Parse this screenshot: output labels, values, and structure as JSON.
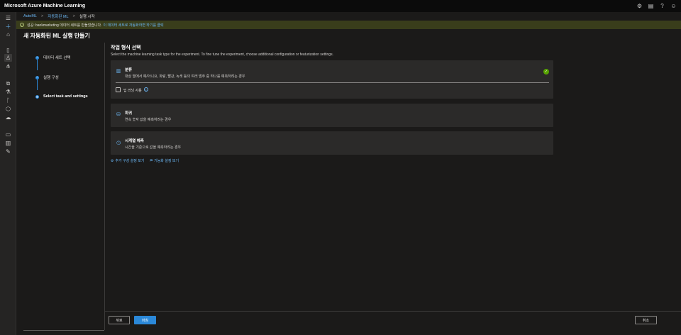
{
  "app": {
    "title": "Microsoft Azure Machine Learning"
  },
  "topbar": {
    "icons": [
      "gear-icon",
      "directory-icon",
      "help-icon",
      "smiley-icon"
    ]
  },
  "breadcrumb": {
    "items": [
      "AutoML",
      "자동화된 ML",
      "실행 시작"
    ]
  },
  "notice": {
    "text": "성공: bankmarketing 데이터 세트를 만들었습니다.",
    "link": "이 데이터 세트로 자동화하면 하기를 클릭"
  },
  "page": {
    "title": "새 자동화된 ML 실행 만들기"
  },
  "steps": [
    {
      "label": "데이터 세트 선택",
      "state": "done"
    },
    {
      "label": "실행 구성",
      "state": "done"
    },
    {
      "label": "Select task and settings",
      "state": "current"
    }
  ],
  "main": {
    "title": "작업 형식 선택",
    "description": "Select the machine learning task type for the experiment. To fine tune the experiment, choose additional configuration or featurization settings."
  },
  "tasks": {
    "classification": {
      "title": "분류",
      "desc": "대상 열에서 예/아니요, 파랑, 빨강, 녹색 등의 여러 범주 중 하나를 예측하려는 경우",
      "selected": true,
      "deep_learning_label": "딥 러닝 사용"
    },
    "regression": {
      "title": "회귀",
      "desc": "연속 숫자 값을 예측하려는 경우"
    },
    "forecasting": {
      "title": "시계열 예측",
      "desc": "시간을 기준으로 값을 예측하려는 경우"
    }
  },
  "links": {
    "config": "추가 구성 설정 보기",
    "featurization": "기능화 설정 보기"
  },
  "footer": {
    "back": "뒤로",
    "next": "마침",
    "cancel": "취소"
  }
}
